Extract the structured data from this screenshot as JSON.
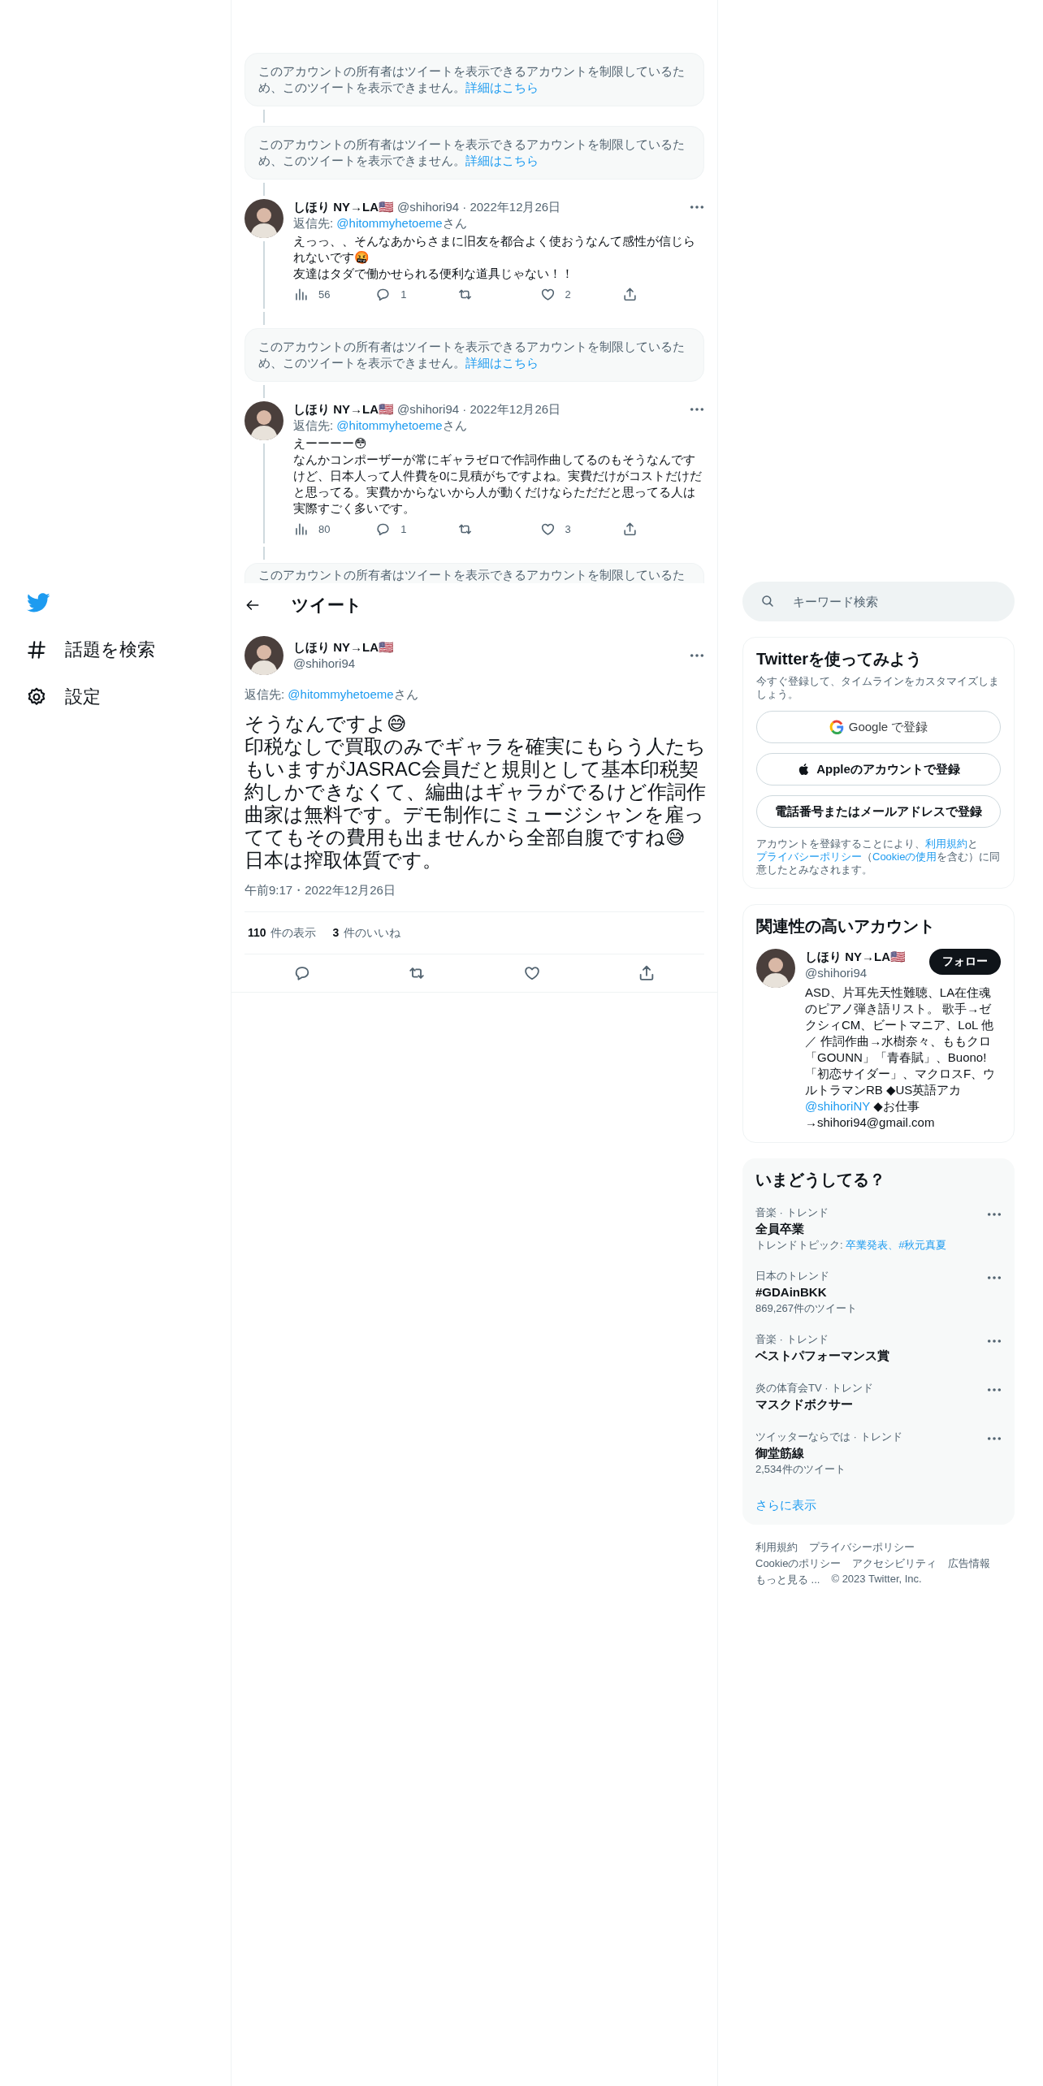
{
  "nav": {
    "items": [
      {
        "kind": "logo"
      },
      {
        "kind": "explore",
        "label": "話題を検索"
      },
      {
        "kind": "settings",
        "label": "設定"
      }
    ]
  },
  "timeline": [
    {
      "kind": "restricted",
      "text": "このアカウントの所有者はツイートを表示できるアカウントを制限しているため、このツイートを表示できません。",
      "link": "詳細はこちら"
    },
    {
      "kind": "restricted",
      "text": "このアカウントの所有者はツイートを表示できるアカウントを制限しているため、このツイートを表示できません。",
      "link": "詳細はこちら"
    },
    {
      "kind": "tweet",
      "name": "しほり NY→LA🇺🇸",
      "meta": "@shihori94 · 2022年12月26日",
      "reply_prefix": "返信先: ",
      "reply_to": "@hitommyhetoeme",
      "reply_suffix": "さん",
      "text": "えっっ、、そんなあからさまに旧友を都合よく使おうなんて感性が信じられないです🤬\n友達はタダで働かせられる便利な道具じゃない！！",
      "views": "56",
      "replies": "1",
      "likes": "2"
    },
    {
      "kind": "restricted",
      "text": "このアカウントの所有者はツイートを表示できるアカウントを制限しているため、このツイートを表示できません。",
      "link": "詳細はこちら"
    },
    {
      "kind": "tweet",
      "name": "しほり NY→LA🇺🇸",
      "meta": "@shihori94 · 2022年12月26日",
      "reply_prefix": "返信先: ",
      "reply_to": "@hitommyhetoeme",
      "reply_suffix": "さん",
      "text": "えーーーー😳\nなんかコンポーザーが常にギャラゼロで作詞作曲してるのもそうなんですけど、日本人って人件費を0に見積がちですよね。実費だけがコストだけだと思ってる。実費かからないから人が動くだけならただだと思ってる人は実際すごく多いです。",
      "views": "80",
      "replies": "1",
      "likes": "3"
    },
    {
      "kind": "partial",
      "text": "このアカウントの所有者はツイートを表示できるアカウントを制限しているた"
    }
  ],
  "header": {
    "title": "ツイート"
  },
  "main_tweet": {
    "name": "しほり NY→LA🇺🇸",
    "handle": "@shihori94",
    "reply_prefix": "返信先: ",
    "reply_to": "@hitommyhetoeme",
    "reply_suffix": "さん",
    "text": "そうなんですよ😅\n印税なしで買取のみでギャラを確実にもらう人たちもいますがJASRAC会員だと規則として基本印税契約しかできなくて、編曲はギャラがでるけど作詞作曲家は無料です。デモ制作にミュージシャンを雇っててもその費用も出ませんから全部自腹ですね😅\n日本は搾取体質です。",
    "time": "午前9:17・2022年12月26日",
    "views_count": "110",
    "views_label": "件の表示",
    "likes_count": "3",
    "likes_label": "件のいいね"
  },
  "search": {
    "placeholder": "キーワード検索"
  },
  "signup": {
    "title": "Twitterを使ってみよう",
    "subtitle": "今すぐ登録して、タイムラインをカスタマイズしましょう。",
    "buttons": [
      {
        "kind": "google",
        "label": "Google で登録"
      },
      {
        "kind": "apple",
        "label": "Appleのアカウントで登録"
      },
      {
        "kind": "plain",
        "label": "電話番号またはメールアドレスで登録"
      }
    ],
    "legal": [
      {
        "text": "アカウントを登録することにより、",
        "link": false
      },
      {
        "text": "利用規約",
        "link": true
      },
      {
        "text": "と",
        "link": false
      },
      {
        "text": "プライバシーポリシー",
        "link": true
      },
      {
        "text": "（",
        "link": false
      },
      {
        "text": "Cookieの使用",
        "link": true
      },
      {
        "text": "を含む）に同意したとみなされます。",
        "link": false
      }
    ]
  },
  "related": {
    "title": "関連性の高いアカウント",
    "accounts": [
      {
        "name": "しほり NY→LA🇺🇸",
        "handle": "@shihori94",
        "follow": "フォロー",
        "bio": [
          {
            "text": "ASD、片耳先天性難聴、LA在住魂のピアノ弾き語リスト。 歌手→ゼクシィCM、ビートマニア、LoL 他／ 作詞作曲→水樹奈々、ももクロ「GOUNN」「青春賦」、Buono!「初恋サイダー」、マクロスF、ウルトラマンRB ◆US英語アカ ",
            "link": false
          },
          {
            "text": "@shihoriNY",
            "link": true
          },
          {
            "text": " ◆お仕事→shihori94@gmail.com",
            "link": false
          }
        ]
      }
    ]
  },
  "trends": {
    "title": "いまどうしてる？",
    "items": [
      {
        "context": "音楽 · トレンド",
        "title": "全員卒業",
        "topics_prefix": "トレンドトピック: ",
        "topics": "卒業発表、#秋元真夏"
      },
      {
        "context": "日本のトレンド",
        "title": "#GDAinBKK",
        "count": "869,267件のツイート"
      },
      {
        "context": "音楽 · トレンド",
        "title": "ベストパフォーマンス賞"
      },
      {
        "context": "炎の体育会TV · トレンド",
        "title": "マスクドボクサー"
      },
      {
        "context": "ツイッターならでは · トレンド",
        "title": "御堂筋線",
        "count": "2,534件のツイート"
      }
    ],
    "more": "さらに表示"
  },
  "footer": {
    "links": [
      "利用規約",
      "プライバシーポリシー",
      "Cookieのポリシー",
      "アクセシビリティ",
      "広告情報",
      "もっと見る ...",
      "© 2023 Twitter, Inc."
    ]
  }
}
